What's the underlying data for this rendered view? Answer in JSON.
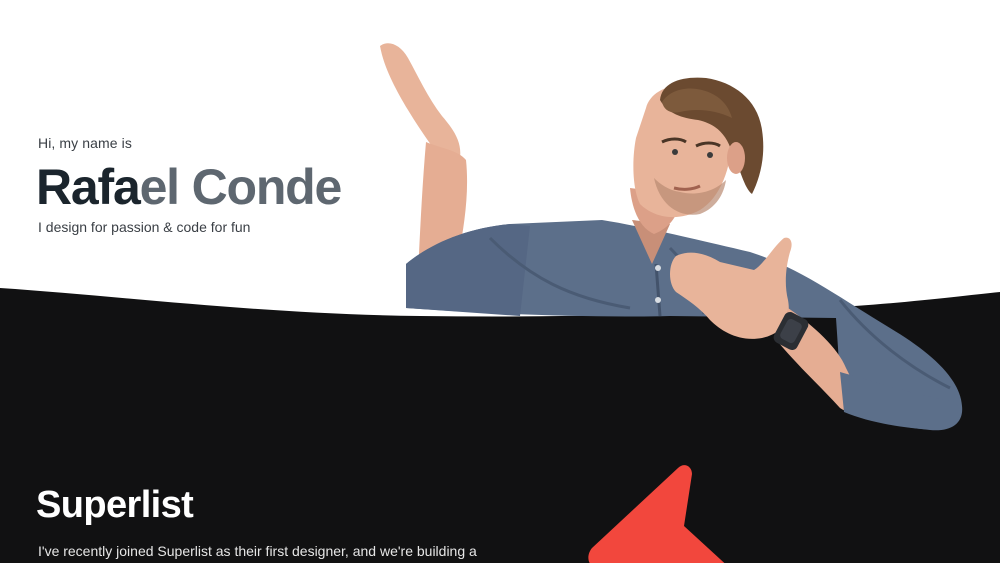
{
  "hero": {
    "intro": "Hi, my name is",
    "name_dark": "Rafa",
    "name_light": "el Conde",
    "tagline": "I design for passion & code for fun"
  },
  "section": {
    "title": "Superlist",
    "text": "I've recently joined Superlist as their first designer, and we're building a"
  },
  "icons": {
    "cursor": "arrow-cursor-icon",
    "photo": "person-photo"
  },
  "colors": {
    "background": "#ffffff",
    "band": "#111112",
    "name_dark": "#1b252d",
    "name_light": "#5e6770",
    "accent": "#f2473d"
  }
}
